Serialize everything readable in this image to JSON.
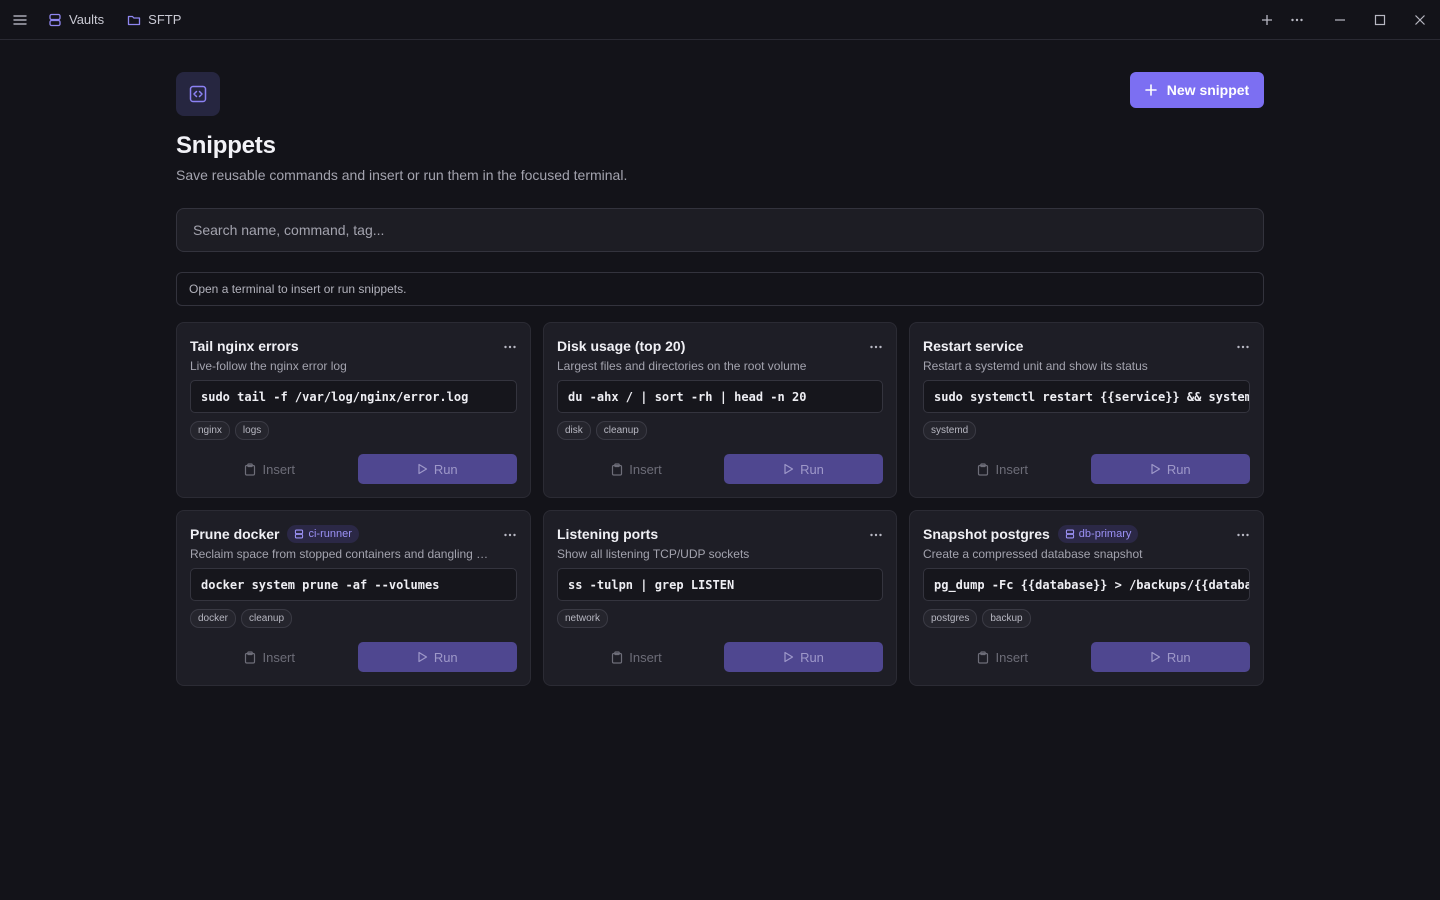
{
  "titlebar": {
    "tabs": [
      {
        "label": "Vaults",
        "icon": "server-stack-icon"
      },
      {
        "label": "SFTP",
        "icon": "folder-icon"
      }
    ]
  },
  "header": {
    "title": "Snippets",
    "subtitle": "Save reusable commands and insert or run them in the focused terminal.",
    "new_button_label": "New snippet"
  },
  "search": {
    "placeholder": "Search name, command, tag...",
    "value": ""
  },
  "notice": "Open a terminal to insert or run snippets.",
  "snippets": [
    {
      "name": "Tail nginx errors",
      "host": null,
      "description": "Live-follow the nginx error log",
      "command": "sudo tail -f /var/log/nginx/error.log",
      "tags": [
        "nginx",
        "logs"
      ]
    },
    {
      "name": "Disk usage (top 20)",
      "host": null,
      "description": "Largest files and directories on the root volume",
      "command": "du -ahx / | sort -rh | head -n 20",
      "tags": [
        "disk",
        "cleanup"
      ]
    },
    {
      "name": "Restart service",
      "host": null,
      "description": "Restart a systemd unit and show its status",
      "command": "sudo systemctl restart {{service}} && systemctl status {{service}}",
      "tags": [
        "systemd"
      ]
    },
    {
      "name": "Prune docker",
      "host": "ci-runner",
      "description": "Reclaim space from stopped containers and dangling images",
      "command": "docker system prune -af --volumes",
      "tags": [
        "docker",
        "cleanup"
      ]
    },
    {
      "name": "Listening ports",
      "host": null,
      "description": "Show all listening TCP/UDP sockets",
      "command": "ss -tulpn | grep LISTEN",
      "tags": [
        "network"
      ]
    },
    {
      "name": "Snapshot postgres",
      "host": "db-primary",
      "description": "Create a compressed database snapshot",
      "command": "pg_dump -Fc {{database}} > /backups/{{database}}.dump",
      "tags": [
        "postgres",
        "backup"
      ]
    }
  ],
  "labels": {
    "insert": "Insert",
    "run": "Run"
  },
  "colors": {
    "accent": "#7c6ff2",
    "background": "#131319",
    "card": "#1e1e26"
  }
}
